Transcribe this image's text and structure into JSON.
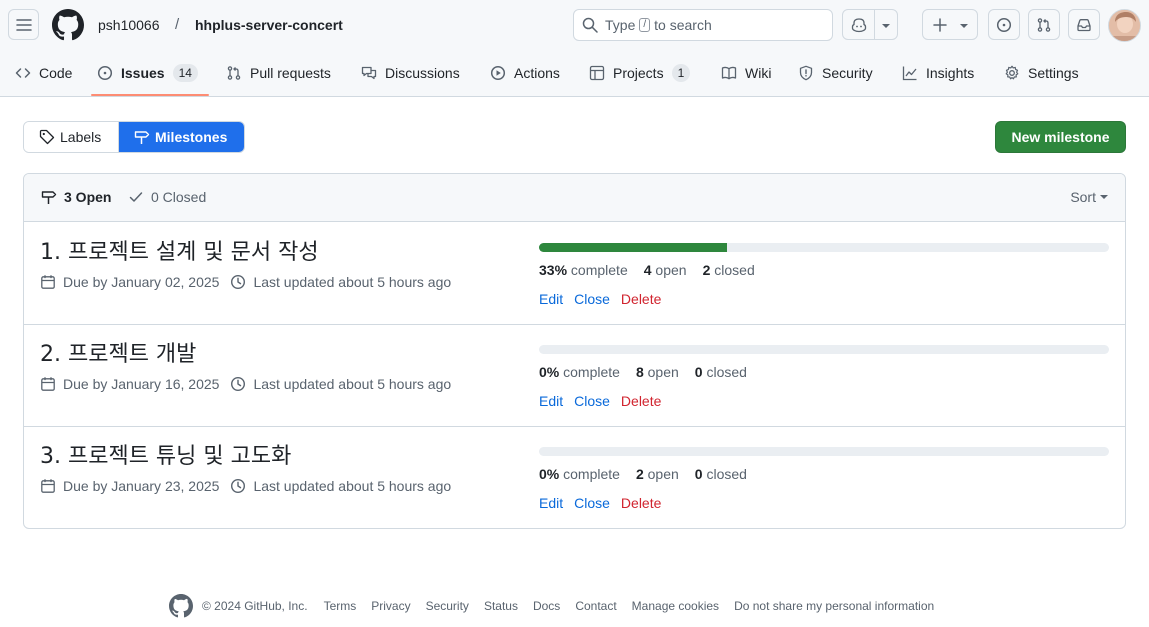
{
  "header": {
    "owner": "psh10066",
    "separator": "/",
    "repo": "hhplus-server-concert",
    "search": {
      "prefix": "Type",
      "key": "/",
      "suffix": "to search"
    }
  },
  "nav": {
    "code": "Code",
    "issues": "Issues",
    "issues_count": "14",
    "pull_requests": "Pull requests",
    "discussions": "Discussions",
    "actions": "Actions",
    "projects": "Projects",
    "projects_count": "1",
    "wiki": "Wiki",
    "security": "Security",
    "insights": "Insights",
    "settings": "Settings"
  },
  "subnav": {
    "labels": "Labels",
    "milestones": "Milestones"
  },
  "new_milestone_label": "New milestone",
  "list_header": {
    "open": "3 Open",
    "closed": "0 Closed",
    "sort": "Sort"
  },
  "milestones": [
    {
      "title": "1. 프로젝트 설계 및 문서 작성",
      "due": "Due by January 02, 2025",
      "updated": "Last updated about 5 hours ago",
      "progress": 33,
      "pct": "33%",
      "complete_label": "complete",
      "open_count": "4",
      "open_label": "open",
      "closed_count": "2",
      "closed_label": "closed"
    },
    {
      "title": "2. 프로젝트 개발",
      "due": "Due by January 16, 2025",
      "updated": "Last updated about 5 hours ago",
      "progress": 0,
      "pct": "0%",
      "complete_label": "complete",
      "open_count": "8",
      "open_label": "open",
      "closed_count": "0",
      "closed_label": "closed"
    },
    {
      "title": "3. 프로젝트 튜닝 및 고도화",
      "due": "Due by January 23, 2025",
      "updated": "Last updated about 5 hours ago",
      "progress": 0,
      "pct": "0%",
      "complete_label": "complete",
      "open_count": "2",
      "open_label": "open",
      "closed_count": "0",
      "closed_label": "closed"
    }
  ],
  "row_actions": {
    "edit": "Edit",
    "close": "Close",
    "delete": "Delete"
  },
  "footer": {
    "copyright": "© 2024 GitHub, Inc.",
    "links": [
      "Terms",
      "Privacy",
      "Security",
      "Status",
      "Docs",
      "Contact",
      "Manage cookies",
      "Do not share my personal information"
    ]
  },
  "colors": {
    "accent_blue": "#1f6feb",
    "primary_green": "#2e873d",
    "danger_red": "#d1242f",
    "link_blue": "#0969da",
    "tab_underline": "#fd8c73"
  }
}
